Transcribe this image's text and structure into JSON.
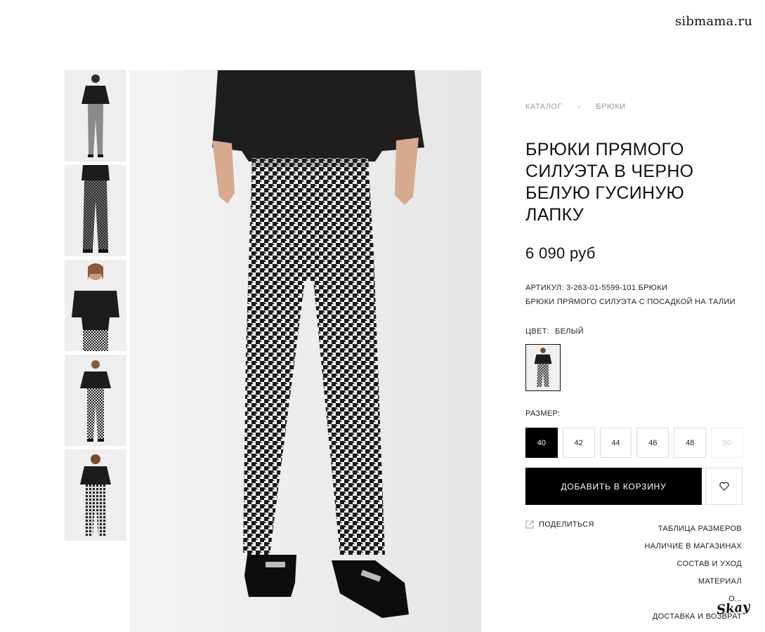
{
  "watermark": "sibmama.ru",
  "breadcrumb": {
    "catalog": "КАТАЛОГ",
    "separator": "-",
    "category": "БРЮКИ"
  },
  "product": {
    "title": "БРЮКИ ПРЯМОГО СИЛУЭТА В ЧЕРНО БЕЛУЮ ГУСИНУЮ ЛАПКУ",
    "price": "6 090 руб",
    "article": "АРТИКУЛ: 3-263-01-5599-101 БРЮКИ",
    "description": "БРЮКИ ПРЯМОГО СИЛУЭТА С ПОСАДКОЙ НА ТАЛИИ",
    "color_label": "ЦВЕТ:",
    "color_value": "БЕЛЫЙ",
    "size_label": "РАЗМЕР:",
    "sizes": [
      {
        "label": "40",
        "state": "selected"
      },
      {
        "label": "42",
        "state": "available"
      },
      {
        "label": "44",
        "state": "available"
      },
      {
        "label": "46",
        "state": "available"
      },
      {
        "label": "48",
        "state": "available"
      },
      {
        "label": "50",
        "state": "unavailable"
      }
    ],
    "add_to_cart": "ДОБАВИТЬ В КОРЗИНУ"
  },
  "actions": {
    "share": "ПОДЕЛИТЬСЯ",
    "size_chart": "ТАБЛИЦА РАЗМЕРОВ",
    "in_stores": "НАЛИЧИЕ В МАГАЗИНАХ",
    "composition": "СОСТАВ И УХОД",
    "material": "МАТЕРИАЛ",
    "about": "О...",
    "delivery": "ДОСТАВКА И ВОЗВРАТ"
  },
  "signature": "Skay",
  "icons": {
    "share": "share-icon",
    "favorite": "heart-icon"
  },
  "colors": {
    "accent": "#000000",
    "muted": "#9a9a9a",
    "border": "#dcdcdc"
  }
}
